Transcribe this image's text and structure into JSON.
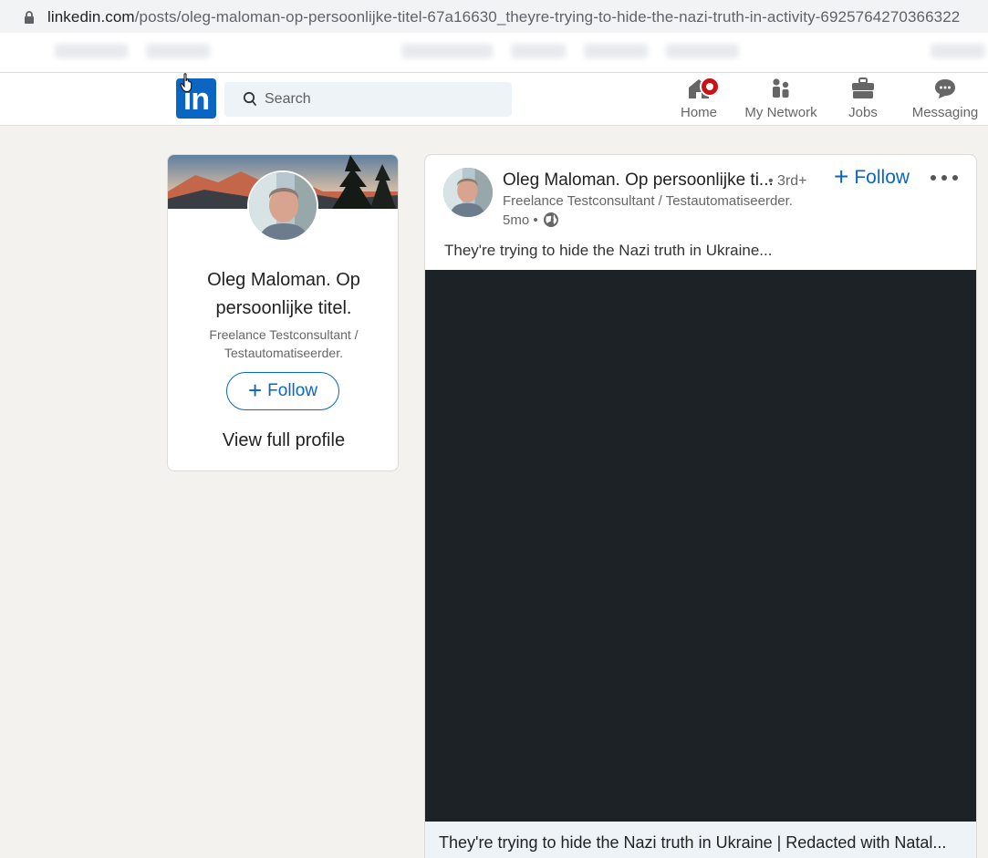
{
  "browser": {
    "url_domain": "linkedin.com",
    "url_path": "/posts/oleg-maloman-op-persoonlijke-titel-67a16630_theyre-trying-to-hide-the-nazi-truth-in-activity-6925764270366322"
  },
  "nav": {
    "logo": "in",
    "search_placeholder": "Search",
    "items": [
      {
        "label": "Home",
        "icon": "home-icon",
        "notification": true
      },
      {
        "label": "My Network",
        "icon": "network-icon"
      },
      {
        "label": "Jobs",
        "icon": "briefcase-icon"
      },
      {
        "label": "Messaging",
        "icon": "chat-icon"
      }
    ]
  },
  "profile_card": {
    "name": "Oleg Maloman. Op persoonlijke titel.",
    "headline": "Freelance Testconsultant / Testautomatiseerder.",
    "follow_label": "Follow",
    "view_profile": "View full profile"
  },
  "post": {
    "author": "Oleg Maloman. Op persoonlijke ti...",
    "degree": "• 3rd+",
    "headline": "Freelance Testconsultant / Testautomatiseerder.",
    "time": "5mo •",
    "follow_label": "Follow",
    "text": "They're trying to hide the Nazi truth in Ukraine...",
    "link_title": "They're trying to hide the Nazi truth in Ukraine | Redacted with Natal..."
  },
  "colors": {
    "brand": "#0a66c2",
    "video_bg": "#1d2226",
    "page_bg": "#f3f2ef",
    "badge": "#cc1016"
  }
}
